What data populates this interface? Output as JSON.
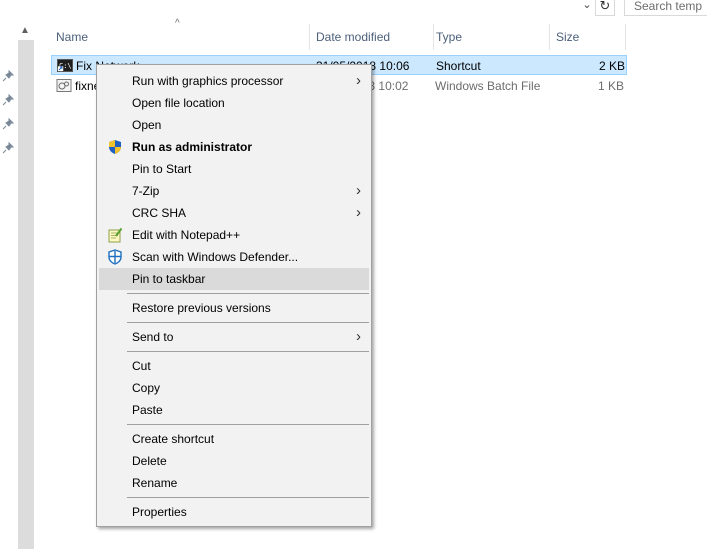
{
  "toolbar": {
    "refresh_icon": "refresh-icon",
    "search_placeholder": "Search temp"
  },
  "columns": {
    "name": "Name",
    "date": "Date modified",
    "type": "Type",
    "size": "Size"
  },
  "files": [
    {
      "name": "Fix Network",
      "date": "31/05/2018 10:06",
      "type": "Shortcut",
      "size": "2 KB",
      "selected": true
    },
    {
      "name": "fixnetwork",
      "date": "31/05/2018 10:02",
      "type": "Windows Batch File",
      "size": "1 KB",
      "selected": false
    }
  ],
  "context_menu": {
    "items": [
      {
        "label": "Run with graphics processor",
        "submenu": true
      },
      {
        "label": "Open file location"
      },
      {
        "label": "Open"
      },
      {
        "label": "Run as administrator",
        "icon": "uac-shield-icon",
        "bold": true
      },
      {
        "label": "Pin to Start"
      },
      {
        "label": "7-Zip",
        "submenu": true
      },
      {
        "label": "CRC SHA",
        "submenu": true
      },
      {
        "label": "Edit with Notepad++",
        "icon": "notepad-plus-plus-icon"
      },
      {
        "label": "Scan with Windows Defender...",
        "icon": "windows-defender-icon"
      },
      {
        "label": "Pin to taskbar",
        "hovered": true
      },
      {
        "label": "Restore previous versions"
      },
      {
        "label": "Send to",
        "submenu": true
      },
      {
        "label": "Cut"
      },
      {
        "label": "Copy"
      },
      {
        "label": "Paste"
      },
      {
        "label": "Create shortcut"
      },
      {
        "label": "Delete"
      },
      {
        "label": "Rename"
      },
      {
        "label": "Properties"
      }
    ],
    "submenu_arrow": "›"
  },
  "colors": {
    "selection_bg": "#cce8ff",
    "selection_border": "#99d1ff",
    "menu_bg": "#f2f2f2",
    "menu_hover": "#dadada",
    "header_text": "#4c607a"
  }
}
